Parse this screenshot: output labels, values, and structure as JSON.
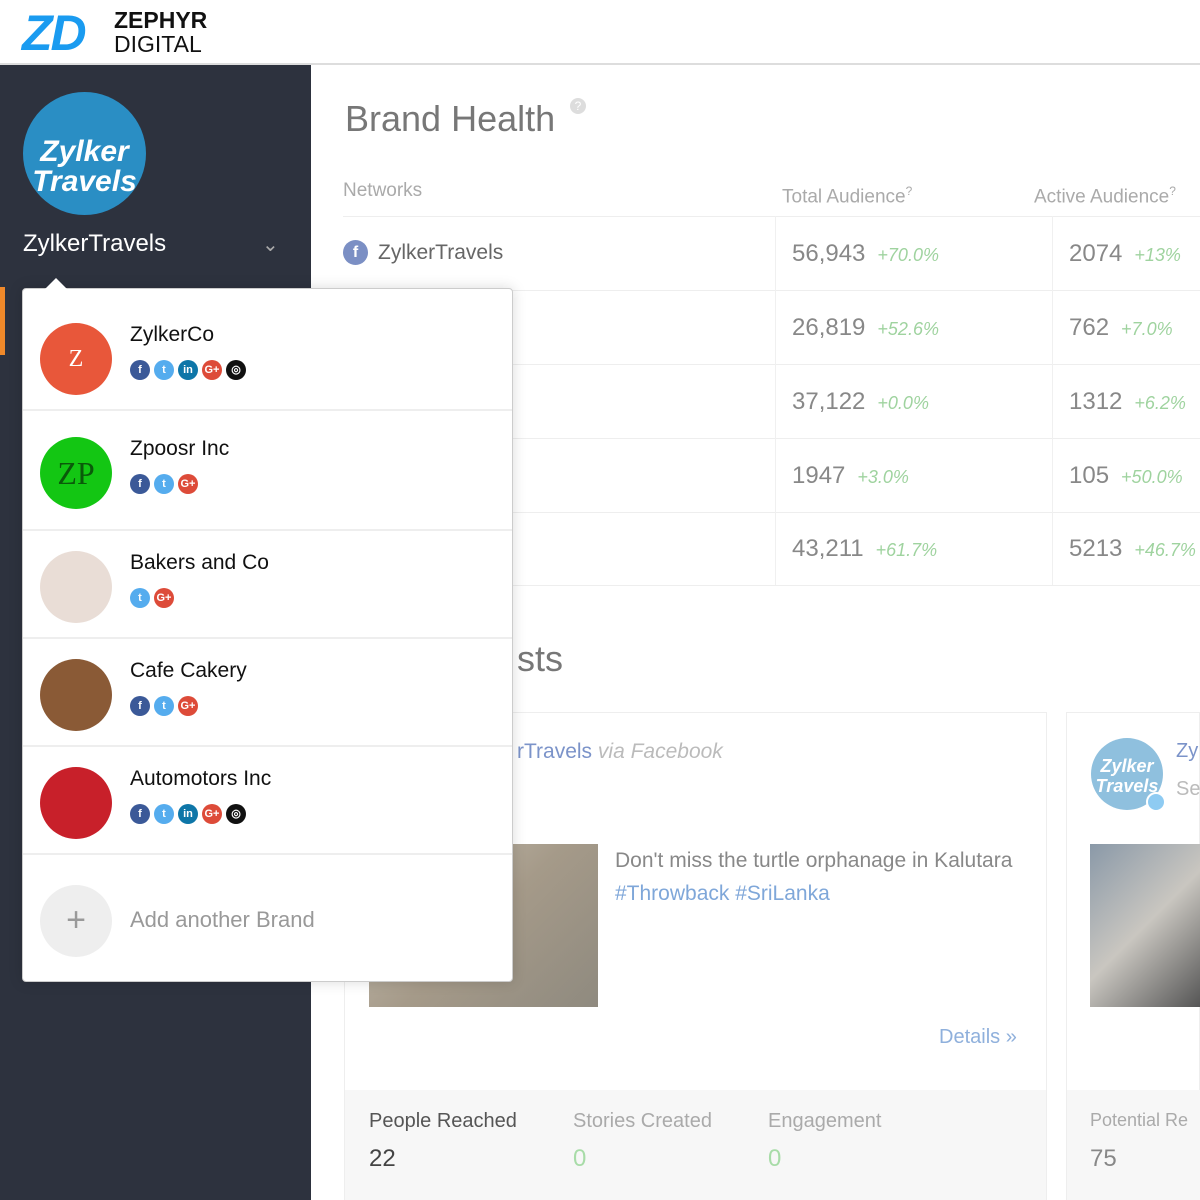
{
  "header": {
    "logo_mark": "ZD",
    "logo_line1": "ZEPHYR",
    "logo_line2": "DIGITAL"
  },
  "sidebar": {
    "brand_avatar_text": "Zylker Travels",
    "brand_name": "ZylkerTravels"
  },
  "brand_health": {
    "title": "Brand Health",
    "help": "?",
    "columns": [
      "Networks",
      "Total Audience",
      "Active Audience"
    ],
    "first_network": "ZylkerTravels",
    "rows": [
      {
        "total": "56,943",
        "total_change": "+70.0%",
        "active": "2074",
        "active_change": "+13%"
      },
      {
        "total": "26,819",
        "total_change": "+52.6%",
        "active": "762",
        "active_change": "+7.0%"
      },
      {
        "total": "37,122",
        "total_change": "+0.0%",
        "active": "1312",
        "active_change": "+6.2%"
      },
      {
        "total": "1947",
        "total_change": "+3.0%",
        "active": "105",
        "active_change": "+50.0%"
      },
      {
        "total": "43,211",
        "total_change": "+61.7%",
        "active": "5213",
        "active_change": "+46.7%"
      }
    ]
  },
  "posts": {
    "title_fragment": "sts",
    "card1": {
      "author_fragment": "rTravels",
      "via": "via Facebook",
      "text": "Don't miss the turtle orphanage in Kalutara",
      "tags": "#Throwback #SriLanka",
      "details": "Details »",
      "stats": [
        {
          "label": "People Reached",
          "value": "22"
        },
        {
          "label": "Stories Created",
          "value": "0"
        },
        {
          "label": "Engagement",
          "value": "0"
        }
      ]
    },
    "card2": {
      "name_fragment": "Zy",
      "sub_fragment": "Se",
      "stat_label": "Potential Re",
      "stat_value": "75"
    }
  },
  "dropdown": {
    "brands": [
      {
        "name": "ZylkerCo",
        "avatar": "Z",
        "color": "#e8573a",
        "networks": [
          "facebook",
          "twitter",
          "linkedin",
          "google-plus",
          "instagram"
        ]
      },
      {
        "name": "Zpoosr Inc",
        "avatar": "ZP",
        "color": "#13c613",
        "networks": [
          "facebook",
          "twitter",
          "google-plus"
        ]
      },
      {
        "name": "Bakers and Co",
        "avatar": "",
        "color": "#e9ddd6",
        "networks": [
          "twitter",
          "google-plus"
        ]
      },
      {
        "name": "Cafe Cakery",
        "avatar": "",
        "color": "#8a5a36",
        "networks": [
          "facebook",
          "twitter",
          "google-plus"
        ]
      },
      {
        "name": "Automotors Inc",
        "avatar": "",
        "color": "#c8202a",
        "networks": [
          "facebook",
          "twitter",
          "linkedin",
          "google-plus",
          "instagram"
        ]
      }
    ],
    "add_label": "Add another Brand",
    "add_icon": "+"
  }
}
